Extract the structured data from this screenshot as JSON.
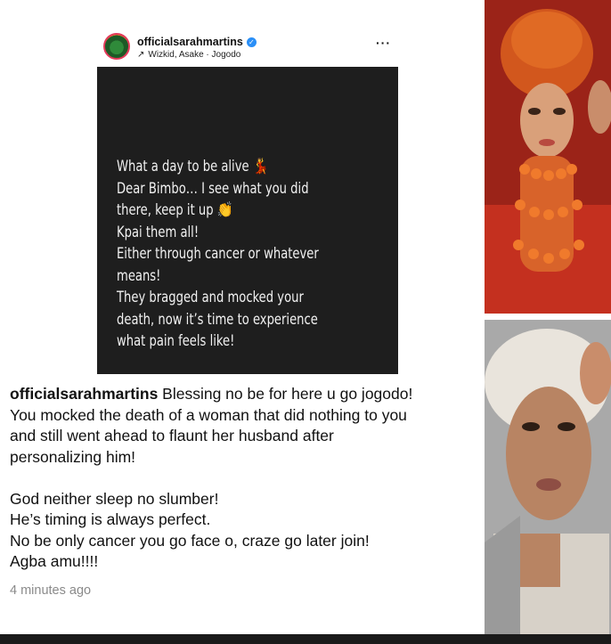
{
  "post": {
    "username": "officialsarahmartins",
    "audio": "Wizkid, Asake · Jogodo",
    "more": "···",
    "image_text_lines": [
      "What a day to be alive 💃",
      "Dear Bimbo… I see what you did",
      "there, keep it up 👏",
      "Kpai them all!",
      "Either through cancer or whatever",
      "means!",
      "They bragged and mocked your",
      "death, now it’s time to experience",
      "what pain feels like!"
    ],
    "caption": {
      "username": "officialsarahmartins",
      "first_line_rest": " Blessing no be for here u go jogodo!",
      "lines": [
        "You mocked the death of a woman that did nothing to you",
        "and still went ahead to flaunt her husband after",
        "personalizing him!"
      ],
      "lines2": [
        "God neither sleep no slumber!",
        "He’s timing is always perfect.",
        "No be only cancer you go face o, craze go later join!",
        "Agba amu!!!!"
      ]
    },
    "timestamp": "4 minutes ago"
  },
  "colors": {
    "verified": "#2a8ff7",
    "post_bg": "#1e1e1e",
    "timestamp": "#8a8a8a"
  },
  "icons": {
    "verified": "verified-badge-icon",
    "audio": "arrow-up-right-icon",
    "more": "more-options-icon"
  }
}
